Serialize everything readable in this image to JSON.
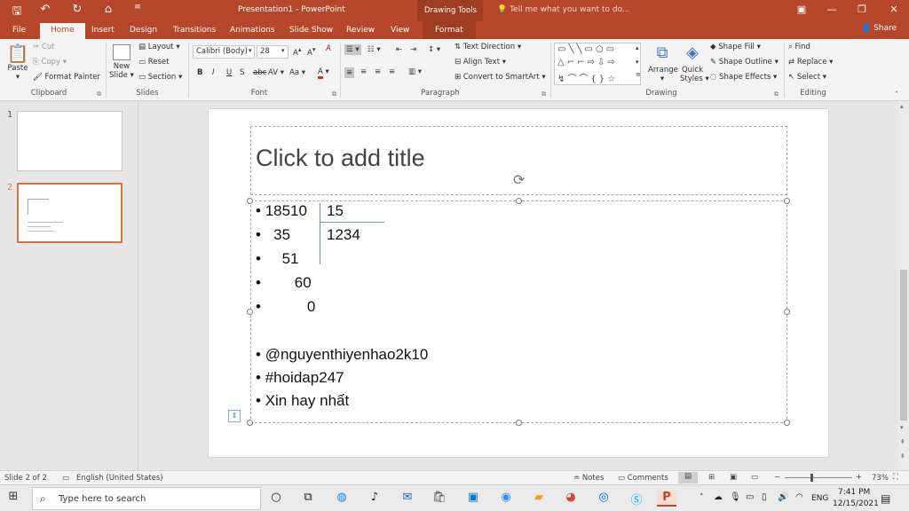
{
  "window": {
    "title": "Presentation1 - PowerPoint",
    "context_tab_group": "Drawing Tools",
    "tell_me_placeholder": "Tell me what you want to do...",
    "share_label": "Share"
  },
  "tabs": [
    "File",
    "Home",
    "Insert",
    "Design",
    "Transitions",
    "Animations",
    "Slide Show",
    "Review",
    "View",
    "Format"
  ],
  "ribbon": {
    "clipboard": {
      "paste": "Paste",
      "cut": "Cut",
      "copy": "Copy",
      "format_painter": "Format Painter",
      "label": "Clipboard"
    },
    "slides": {
      "new_slide": "New",
      "new_slide2": "Slide",
      "layout": "Layout",
      "reset": "Reset",
      "section": "Section",
      "label": "Slides"
    },
    "font": {
      "name": "Calibri (Body)",
      "size": "28",
      "label": "Font",
      "bold": "B",
      "italic": "I",
      "underline": "U",
      "shadow": "S",
      "strike": "abc",
      "spacing": "AV",
      "case": "Aa"
    },
    "paragraph": {
      "text_direction": "Text Direction",
      "align_text": "Align Text",
      "smartart": "Convert to SmartArt",
      "label": "Paragraph"
    },
    "drawing": {
      "arrange": "Arrange",
      "quick": "Quick",
      "styles": "Styles",
      "shape_fill": "Shape Fill",
      "shape_outline": "Shape Outline",
      "shape_effects": "Shape Effects",
      "label": "Drawing"
    },
    "editing": {
      "find": "Find",
      "replace": "Replace",
      "select": "Select",
      "label": "Editing"
    }
  },
  "slides_panel": {
    "items": [
      "1",
      "2"
    ]
  },
  "slide": {
    "title_placeholder": "Click to add title",
    "division": {
      "dividend_lines": [
        "18510",
        "35",
        "51",
        "60",
        "0"
      ],
      "divisor": "15",
      "quotient": "1234"
    },
    "extra_bullets": [
      "@nguyenthiyenhao2k10",
      "#hoidap247",
      "Xin hay nhất"
    ]
  },
  "status": {
    "slide_indicator": "Slide 2 of 2",
    "language": "English (United States)",
    "notes": "Notes",
    "comments": "Comments",
    "zoom": "73%"
  },
  "taskbar": {
    "search_placeholder": "Type here to search",
    "time": "7:41 PM",
    "date": "12/15/2021",
    "lang": "ENG"
  },
  "colors": {
    "accent": "#b7472a",
    "selected_thumb": "#e0703f"
  }
}
